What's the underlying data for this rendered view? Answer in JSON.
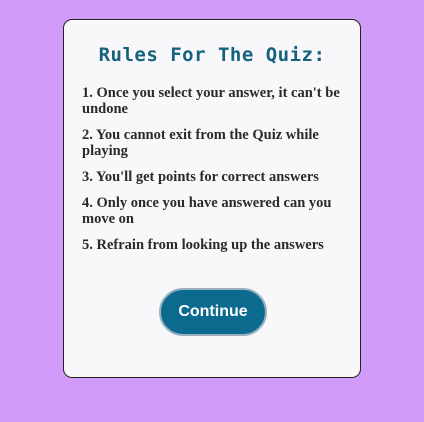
{
  "quiz_rules": {
    "title": "Rules For The Quiz:",
    "rules": [
      "1. Once you select your answer, it can't be undone",
      "2. You cannot exit from the Quiz while playing",
      "3. You'll get points for correct answers",
      "4. Only once you have answered can you move on",
      "5. Refrain from looking up the answers"
    ],
    "continue_label": "Continue"
  },
  "colors": {
    "background": "#d19cf9",
    "card": "#f8f8fa",
    "title": "#15627e",
    "button": "#0d6a8f"
  }
}
